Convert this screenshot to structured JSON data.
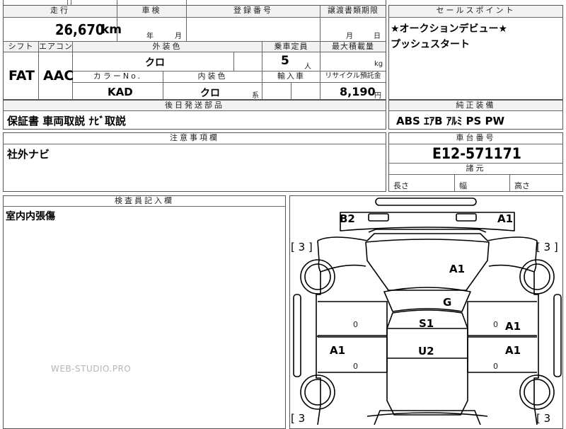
{
  "headers": {
    "mileage": "走行",
    "inspection": "車検",
    "registration": "登録番号",
    "transfer_deadline": "譲渡書類期限",
    "sales_point": "セールスポイント",
    "shift": "シフト",
    "aircon": "エアコン",
    "exterior_color": "外装色",
    "capacity": "乗車定員",
    "max_load": "最大積載量",
    "color_no": "カラーNo.",
    "interior_color": "内装色",
    "import": "輸入車",
    "recycle": "リサイクル預託金",
    "later_parts": "後日発送部品",
    "standard_equipment": "純正装備",
    "notes": "注意事項欄",
    "chassis_number": "車台番号",
    "dimensions": "諸元",
    "inspector": "検査員記入欄"
  },
  "values": {
    "mileage": "26,670",
    "mileage_unit": "km",
    "inspection_year": "年",
    "inspection_month": "月",
    "transfer_month": "月",
    "transfer_day": "日",
    "shift": "FAT",
    "aircon": "AAC",
    "exterior_color": "クロ",
    "capacity": "5",
    "capacity_unit": "人",
    "max_load_unit": "kg",
    "color_no": "KAD",
    "interior_color": "クロ",
    "interior_suffix": "系",
    "recycle": "8,190",
    "recycle_unit": "円",
    "later_parts": "保証書 車両取説 ﾅﾋﾞ取説",
    "standard_equipment": "ABS ｴｱB ｱﾙﾐ PS PW",
    "notes": "社外ナビ",
    "chassis_number": "E12-571171",
    "dim_length": "長さ",
    "dim_width": "幅",
    "dim_height": "高さ",
    "inspector_note": "室内内張傷",
    "sales_point_lines": [
      "★オークションデビュー★",
      "プッシュスタート"
    ]
  },
  "diagram": {
    "marks": {
      "front_left": "B2",
      "front_right": "A1",
      "hood": "A1",
      "windshield": "G",
      "seat_front": "S1",
      "seat_rear": "U2",
      "door_left_rear": "A1",
      "door_right_front": "A1",
      "door_right_rear": "A1",
      "tire_tl": "[ 3 ]",
      "tire_tr": "[ 3 ]",
      "tire_bl": "[ 3",
      "tire_br": "[ 3"
    },
    "pillar_marks": [
      "0",
      "0",
      "0",
      "0"
    ]
  },
  "watermark": "WEB-STUDIO.PRO"
}
